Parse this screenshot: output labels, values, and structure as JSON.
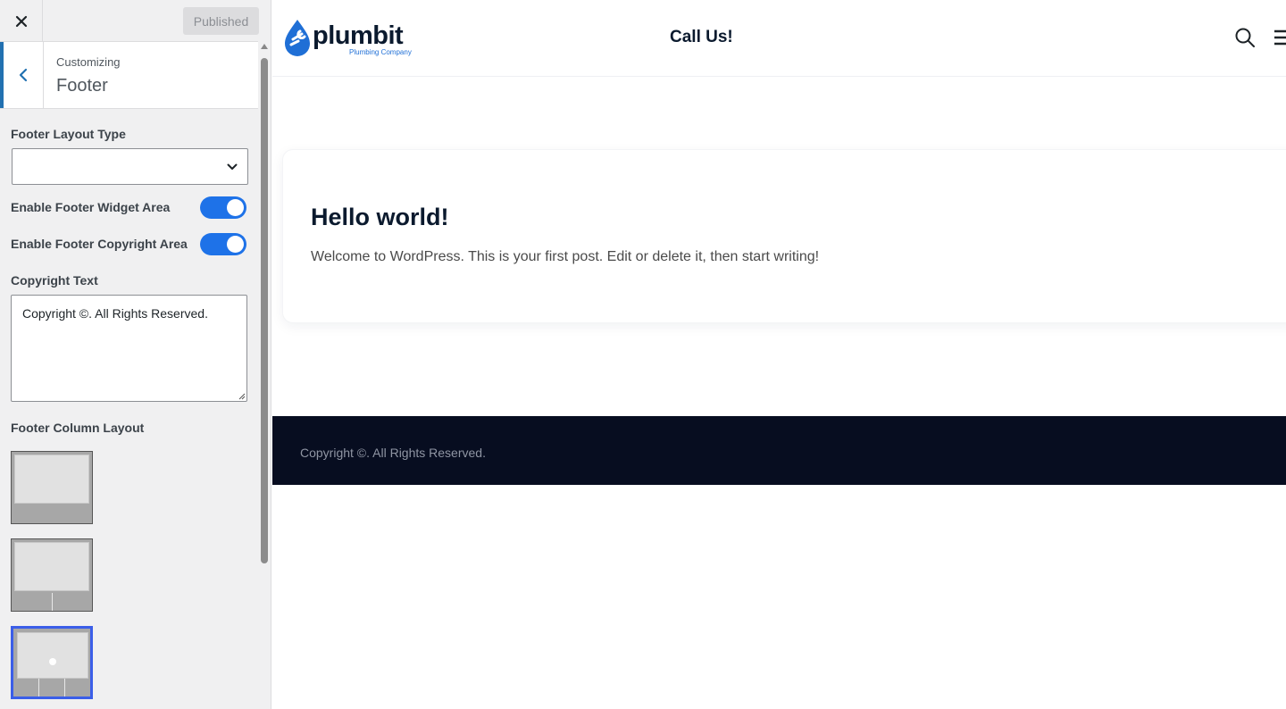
{
  "customizer": {
    "publish_label": "Published",
    "breadcrumb": "Customizing",
    "section_title": "Footer",
    "controls": {
      "footer_layout_type_label": "Footer Layout Type",
      "footer_layout_type_value": "",
      "widget_area_label": "Enable Footer Widget Area",
      "widget_area_enabled": true,
      "copyright_area_label": "Enable Footer Copyright Area",
      "copyright_area_enabled": true,
      "copyright_text_label": "Copyright Text",
      "copyright_text_value": "Copyright ©. All Rights Reserved.",
      "column_layout_label": "Footer Column Layout",
      "column_layout_options": [
        {
          "columns": 1,
          "selected": false
        },
        {
          "columns": 2,
          "selected": false
        },
        {
          "columns": 3,
          "selected": true
        }
      ]
    }
  },
  "site": {
    "logo_word": "plumbit",
    "logo_tagline": "Plumbing Company",
    "header_cta": "Call Us!",
    "brand_colors": {
      "dark": "#0b1a2e",
      "blue": "#1f6fd6",
      "footer_bg": "#070d20"
    }
  },
  "post": {
    "title": "Hello world!",
    "excerpt": "Welcome to WordPress. This is your first post. Edit or delete it, then start writing!"
  },
  "footer": {
    "copyright": "Copyright ©. All Rights Reserved."
  }
}
